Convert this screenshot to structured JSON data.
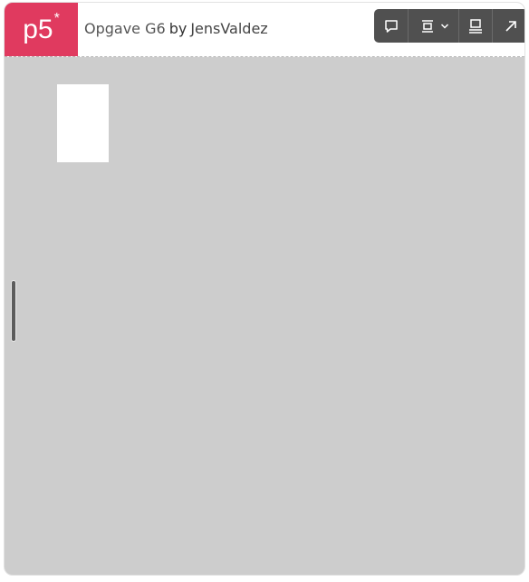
{
  "header": {
    "logo_text": "p5",
    "logo_star": "*",
    "sketch_title": "Opgave G6",
    "by_label": "by",
    "author": "JensValdez"
  },
  "toolbar": {
    "buttons": [
      {
        "icon": "comment-icon"
      },
      {
        "icon": "embed-layout-icon",
        "has_dropdown": true
      },
      {
        "icon": "fullscreen-layout-icon"
      },
      {
        "icon": "open-external-icon"
      }
    ]
  },
  "colors": {
    "logo_bg": "#e03a5f",
    "canvas_bg": "#cdcdcd",
    "toolbar_bg": "#505050",
    "shape_fill": "#ffffff"
  }
}
